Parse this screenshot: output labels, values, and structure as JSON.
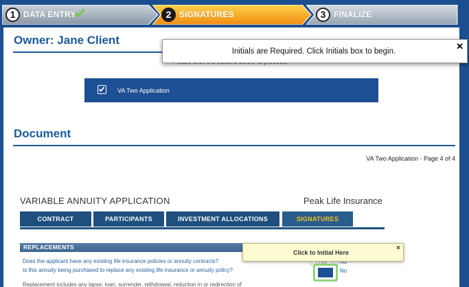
{
  "steps": [
    {
      "number": "1",
      "label": "DATA ENTRY",
      "state": "complete"
    },
    {
      "number": "2",
      "label": "SIGNATURES",
      "state": "active"
    },
    {
      "number": "3",
      "label": "FINALIZE",
      "state": "pending"
    }
  ],
  "colors": {
    "brand_blue": "#1b4f8f",
    "active_step": "#f5a623",
    "check_green": "#7ac943",
    "tab_active_text": "#f3c221"
  },
  "owner": {
    "title": "Owner: Jane Client"
  },
  "instructions": "Please click the buttons below to proceed.",
  "document_button": {
    "label": "VA Two Application",
    "checked": true
  },
  "document": {
    "title": "Document",
    "page_label": "VA Two Application - Page 4 of 4",
    "form_title": "VARIABLE ANNUITY APPLICATION",
    "company": "Peak Life Insurance",
    "tabs": [
      "CONTRACT",
      "PARTICIPANTS",
      "INVESTMENT ALLOCATIONS",
      "SIGNATURES"
    ],
    "active_tab": "SIGNATURES",
    "section": "REPLACEMENTS",
    "questions": [
      "Does the applicant have any existing life insurance policies or annuity contracts?",
      "Is this annuity being purchased to replace any existing life insurance or annuity policy?",
      "Replacement includes any lapse, loan, surrender, withdrawal, reduction in or redirection of"
    ],
    "yes_label": "Yes",
    "no_label": "No"
  },
  "toast": {
    "message": "Initials are Required. Click Initials box to begin.",
    "close": "✕"
  },
  "tooltip": {
    "message": "Click to Initial Here",
    "close": "×"
  }
}
